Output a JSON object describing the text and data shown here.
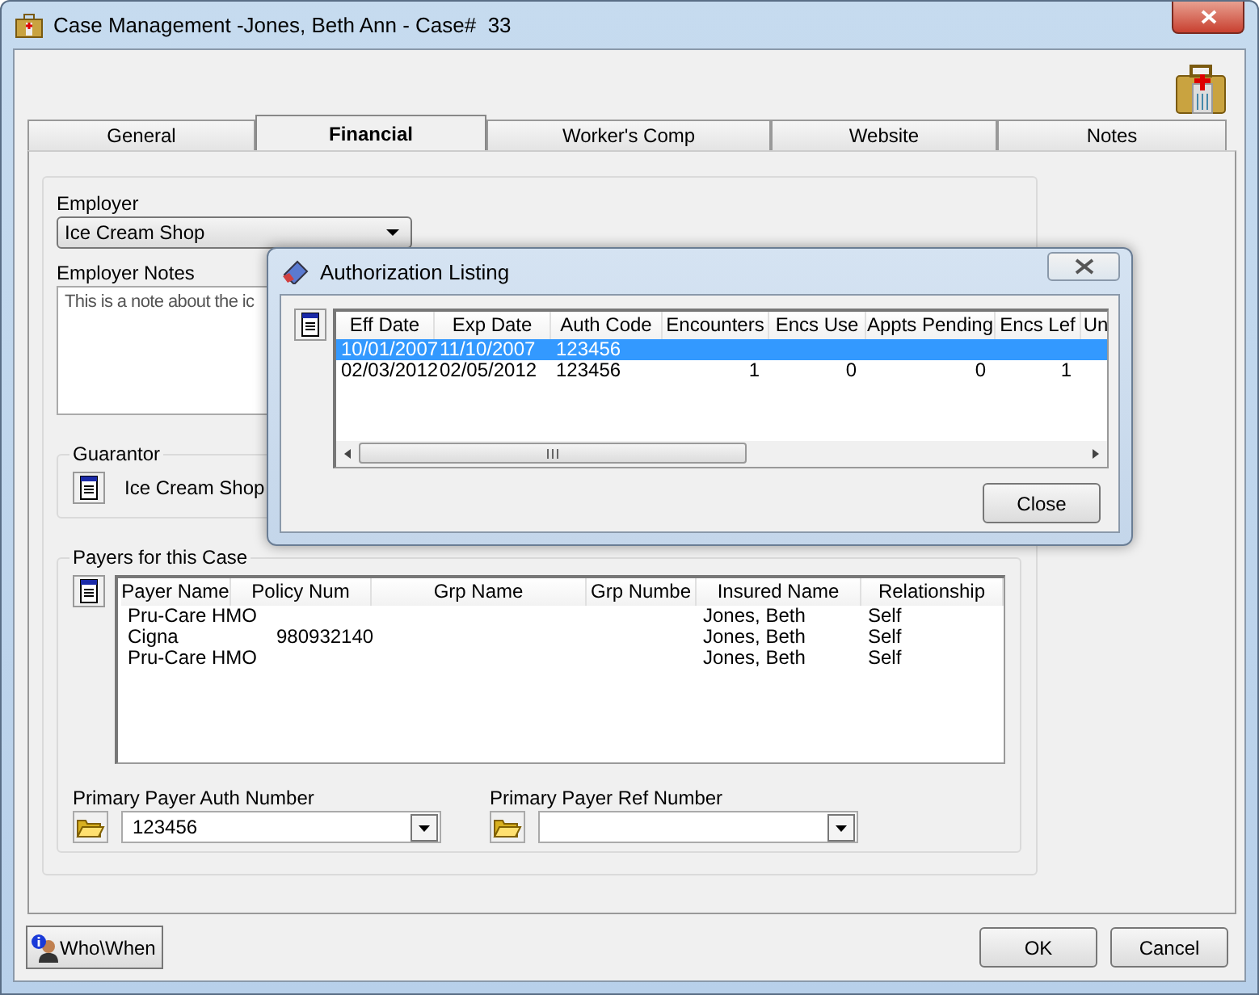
{
  "window": {
    "title": "Case Management -Jones, Beth Ann - Case#  33"
  },
  "tabs": [
    {
      "label": "General",
      "selected": false
    },
    {
      "label": "Financial",
      "selected": true
    },
    {
      "label": "Worker's Comp",
      "selected": false
    },
    {
      "label": "Website",
      "selected": false
    },
    {
      "label": "Notes",
      "selected": false
    }
  ],
  "employer": {
    "label": "Employer",
    "value": "Ice Cream Shop"
  },
  "employer_notes": {
    "label": "Employer Notes",
    "value": "This is a note about the ic"
  },
  "guarantor": {
    "label": "Guarantor",
    "value": "Ice Cream Shop"
  },
  "payers": {
    "label": "Payers for this Case",
    "columns": [
      "Payer Name",
      "Policy Num",
      "Grp Name",
      "Grp Numbe",
      "Insured Name",
      "Relationship"
    ],
    "rows": [
      {
        "payer_name": "Pru-Care HMO",
        "insured_name": "Jones, Beth",
        "relationship": "Self"
      },
      {
        "payer_name": "Cigna",
        "policy_num": "980932140",
        "insured_name": "Jones, Beth",
        "relationship": "Self"
      },
      {
        "payer_name": "Pru-Care HMO",
        "insured_name": "Jones, Beth",
        "relationship": "Self"
      }
    ]
  },
  "auth_number": {
    "label": "Primary Payer Auth Number",
    "value": "123456"
  },
  "ref_number": {
    "label": "Primary Payer Ref Number"
  },
  "buttons": {
    "who_when": "Who\\When",
    "ok": "OK",
    "cancel": "Cancel"
  },
  "dialog": {
    "title": "Authorization Listing",
    "columns": [
      "Eff Date",
      "Exp Date",
      "Auth Code",
      "Encounters",
      "Encs Use",
      "Appts Pending",
      "Encs Lef",
      "Un"
    ],
    "rows": [
      {
        "cells": [
          "10/01/2007",
          "11/10/2007",
          "123456"
        ],
        "selected": true
      },
      {
        "cells": [
          "02/03/2012",
          "02/05/2012",
          "123456",
          "1",
          "0",
          "0",
          "1"
        ],
        "selected": false
      }
    ],
    "close": "Close"
  }
}
